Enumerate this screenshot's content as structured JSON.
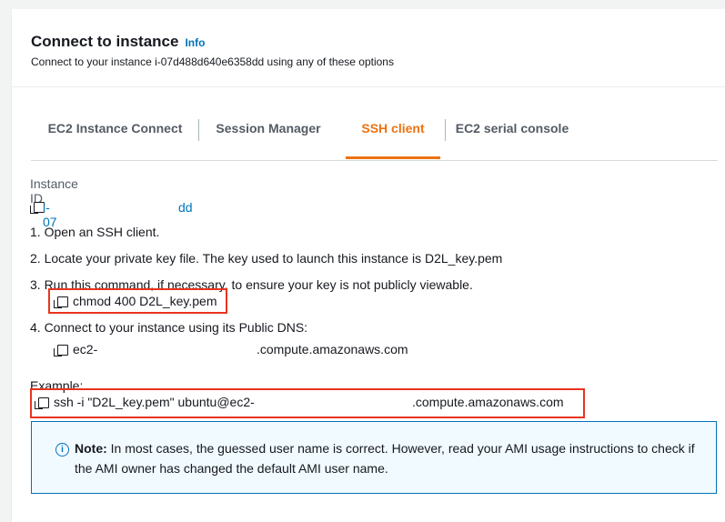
{
  "header": {
    "title": "Connect to instance",
    "info_label": "Info",
    "subtitle": "Connect to your instance i-07d488d640e6358dd using any of these options"
  },
  "tabs": [
    {
      "label": "EC2 Instance Connect",
      "active": false
    },
    {
      "label": "Session Manager",
      "active": false
    },
    {
      "label": "SSH client",
      "active": true
    },
    {
      "label": "EC2 serial console",
      "active": false
    }
  ],
  "instance": {
    "label": "Instance ID",
    "id_visible_start": "i-07",
    "id_visible_end": "dd"
  },
  "steps": [
    "1. Open an SSH client.",
    "2. Locate your private key file. The key used to launch this instance is D2L_key.pem",
    "3. Run this command, if necessary, to ensure your key is not publicly viewable.",
    "4. Connect to your instance using its Public DNS:"
  ],
  "commands": {
    "chmod": "chmod 400 D2L_key.pem",
    "dns_start": "ec2-",
    "dns_end": ".compute.amazonaws.com"
  },
  "example": {
    "label": "Example:",
    "ssh_start": "ssh -i \"D2L_key.pem\" ubuntu@ec2-",
    "ssh_end": ".compute.amazonaws.com"
  },
  "note": {
    "prefix": "Note:",
    "text": "In most cases, the guessed user name is correct. However, read your AMI usage instructions to check if the AMI owner has changed the default AMI user name."
  },
  "colors": {
    "accent": "#ec7211",
    "link": "#0073bb",
    "highlight_box": "#e8341e"
  }
}
